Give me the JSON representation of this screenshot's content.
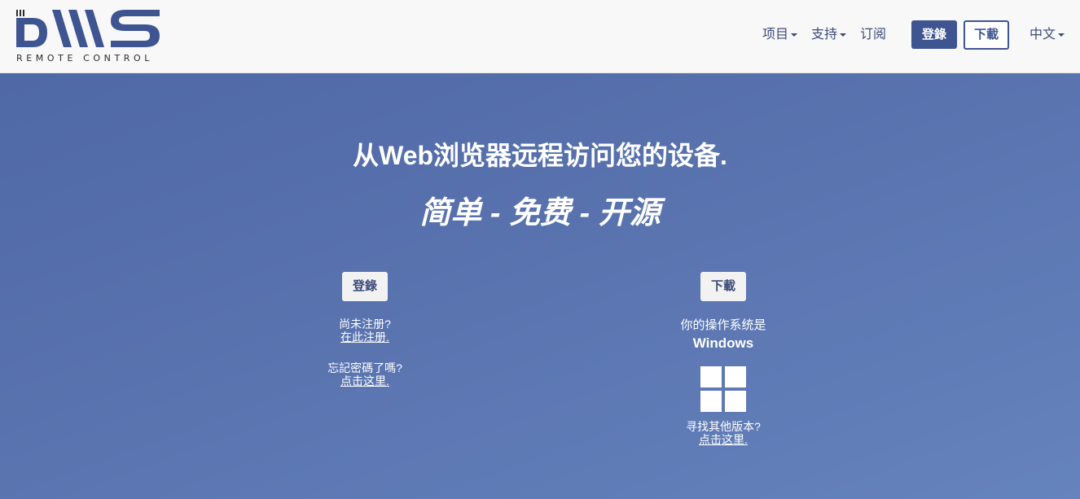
{
  "brand": {
    "name": "DWS",
    "tagline": "REMOTE CONTROL"
  },
  "nav": {
    "items": [
      {
        "label": "项目"
      },
      {
        "label": "支持"
      },
      {
        "label": "订阅"
      },
      {
        "label": "中文"
      }
    ],
    "login_label": "登錄",
    "download_label": "下載"
  },
  "hero": {
    "title": "从Web浏览器远程访问您的设备.",
    "tagline": "简单 - 免费 - 开源"
  },
  "left": {
    "login_label": "登錄",
    "not_registered": "尚未注册?",
    "register_link": "在此注册.",
    "forgot": "忘記密碼了嗎?",
    "forgot_link": "点击这里."
  },
  "right": {
    "download_label": "下載",
    "os_text": "你的操作系统是",
    "os_name": "Windows",
    "other_versions": "寻找其他版本?",
    "other_link": "点击这里."
  },
  "colors": {
    "brand": "#3e5591",
    "hero_bg": "#5a74b0",
    "navbar_bg": "#f8f8f8"
  }
}
